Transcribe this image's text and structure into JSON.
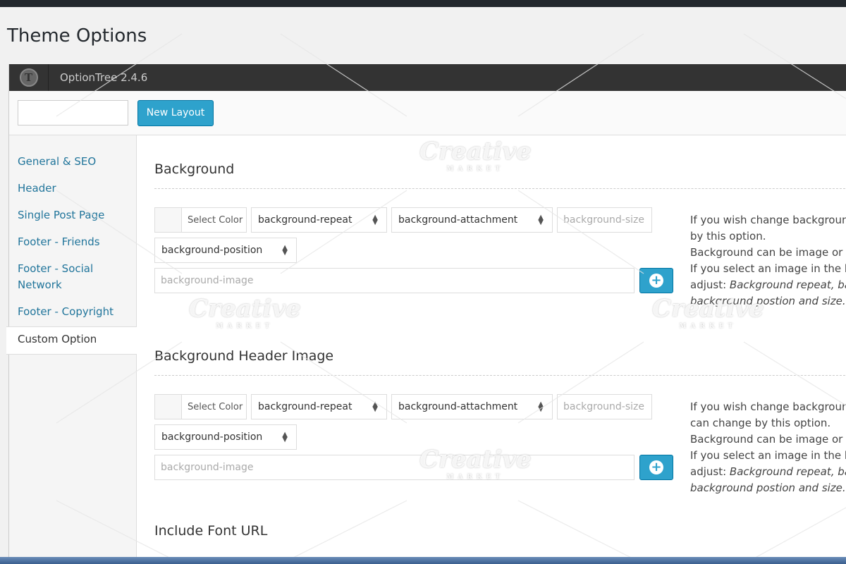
{
  "page": {
    "title": "Theme Options"
  },
  "header": {
    "version": "OptionTree 2.4.6",
    "logo_glyph": "T"
  },
  "toolbar": {
    "layout_input_value": "",
    "new_layout_label": "New Layout"
  },
  "sidebar": {
    "items": [
      {
        "label": "General & SEO"
      },
      {
        "label": "Header"
      },
      {
        "label": "Single Post Page"
      },
      {
        "label": "Footer - Friends"
      },
      {
        "label": "Footer - Social Network"
      },
      {
        "label": "Footer - Copyright"
      },
      {
        "label": "Custom Option"
      }
    ],
    "active_item": "Custom Option"
  },
  "sections": [
    {
      "title": "Background",
      "color_label": "Select Color",
      "repeat": "background-repeat",
      "attachment": "background-attachment",
      "size_placeholder": "background-size",
      "position": "background-position",
      "image_placeholder": "background-image",
      "desc_line1": "If you wish change background",
      "desc_line2": "by this option.",
      "desc_line3": "Background can be image or c",
      "desc_line4": "If you select an image in the ba",
      "desc_line5_prefix": "adjust: ",
      "desc_line5_italic": "Background repeat, bac",
      "desc_line6_italic": "background postion and size."
    },
    {
      "title": "Background Header Image",
      "color_label": "Select Color",
      "repeat": "background-repeat",
      "attachment": "background-attachment",
      "size_placeholder": "background-size",
      "position": "background-position",
      "image_placeholder": "background-image",
      "desc_line1": "If you wish change background",
      "desc_line2": "can change by this option.",
      "desc_line3": "Background can be image or c",
      "desc_line4": "If you select an image in the ba",
      "desc_line5_prefix": "adjust: ",
      "desc_line5_italic": "Background repeat, bac",
      "desc_line6_italic": "background postion and size."
    },
    {
      "title": "Include Font URL"
    }
  ],
  "watermark": {
    "word": "Creative",
    "sub": "MARKET"
  },
  "colors": {
    "accent": "#2ea2cc",
    "header_bg": "#333333",
    "link": "#21759b"
  }
}
